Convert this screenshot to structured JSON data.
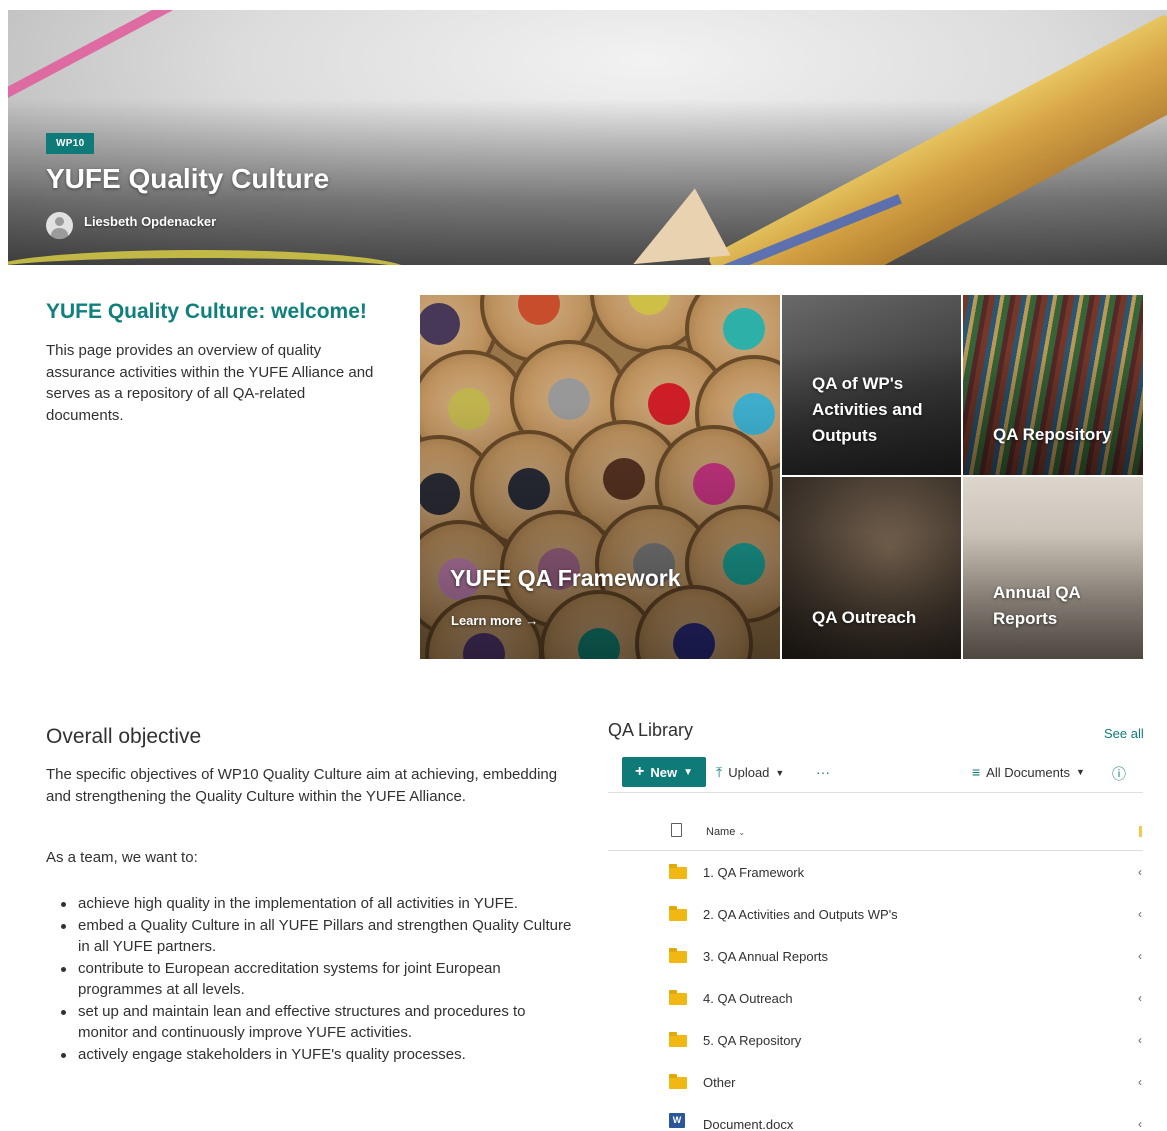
{
  "hero": {
    "badge": "WP10",
    "title": "YUFE Quality Culture",
    "author": "Liesbeth Opdenacker"
  },
  "welcome": {
    "title": "YUFE Quality Culture: welcome!",
    "text": "This page provides an overview of quality assurance activities within the YUFE Alliance and serves as a repository of all QA-related documents."
  },
  "tiles": {
    "main": {
      "title": "YUFE QA Framework",
      "link": "Learn more →"
    },
    "wp": "QA of WP's Activities and Outputs",
    "repository": "QA Repository",
    "outreach": "QA Outreach",
    "annual": "Annual QA Reports"
  },
  "objective": {
    "title": "Overall objective",
    "paragraph": "The specific objectives of WP10 Quality Culture aim at achieving, embedding and strengthening the Quality Culture within the YUFE Alliance.",
    "team_intro": "As a team, we want to:",
    "items": [
      "achieve high quality in the implementation of all activities in YUFE.",
      "embed a Quality Culture in all YUFE Pillars and strengthen Quality Culture in all YUFE partners.",
      "contribute to European accreditation systems for joint European programmes at all levels.",
      "set up and maintain lean and effective structures and procedures to monitor and continuously improve YUFE activities.",
      "actively engage stakeholders in YUFE's quality processes."
    ]
  },
  "library": {
    "title": "QA Library",
    "see_all": "See all",
    "new_label": "New",
    "upload_label": "Upload",
    "more_label": "···",
    "view_label": "All Documents",
    "column_name": "Name",
    "rows": [
      {
        "name": "1. QA Framework",
        "type": "folder"
      },
      {
        "name": "2. QA Activities and Outputs WP's",
        "type": "folder"
      },
      {
        "name": "3. QA Annual Reports",
        "type": "folder"
      },
      {
        "name": "4. QA Outreach",
        "type": "folder"
      },
      {
        "name": "5. QA Repository",
        "type": "folder"
      },
      {
        "name": "Other",
        "type": "folder"
      },
      {
        "name": "Document.docx",
        "type": "word"
      }
    ],
    "trail_char": "‹"
  }
}
